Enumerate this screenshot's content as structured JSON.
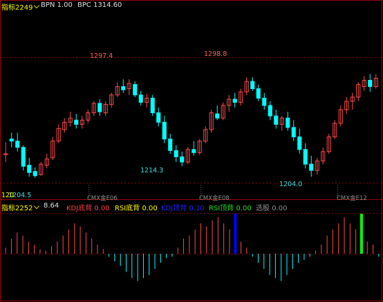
{
  "top_bar": {
    "indicator_name": "指标2249",
    "bpn_label": "BPN",
    "bpn_value": "1.00",
    "bpc_label": "BPC",
    "bpc_value": "1314.60"
  },
  "price_annotations": {
    "high1": "1297.4",
    "high2": "1298.8",
    "low1": "1214.3",
    "low2": "1204.0",
    "left_low": "1204.5",
    "left_axis_stub": "120"
  },
  "period_labels": [
    "CMX金E06",
    "CMX金E08",
    "CMX金E12"
  ],
  "sub_bar": {
    "indicator_name": "指标2252",
    "value": "8.64",
    "kdj_bottom": {
      "label": "KDJ底背",
      "value": "0.00"
    },
    "rsi_bottom": {
      "label": "RSI底背",
      "value": "0.00"
    },
    "kdj_top": {
      "label": "KDJ顶背",
      "value": "0.10"
    },
    "rsi_top": {
      "label": "RSI顶背",
      "value": "0.00"
    },
    "select": {
      "label": "选股",
      "value": "0.00"
    }
  },
  "colors": {
    "up": "#ff4a4a",
    "down": "#00ffff",
    "bg": "#000000",
    "grid": "#8b0000",
    "blue_bar": "#0000ff",
    "green_bar": "#00ff00",
    "yellow": "#ffff00"
  },
  "chart_data": {
    "type": "candlestick",
    "title": "",
    "ylim": [
      1195,
      1320
    ],
    "candles": [
      [
        1225,
        1237,
        1218,
        1226
      ],
      [
        1240,
        1246,
        1232,
        1238
      ],
      [
        1238,
        1246,
        1228,
        1232
      ],
      [
        1232,
        1234,
        1210,
        1214
      ],
      [
        1215,
        1222,
        1204,
        1208
      ],
      [
        1209,
        1213,
        1203,
        1205
      ],
      [
        1206,
        1218,
        1205,
        1216
      ],
      [
        1215,
        1226,
        1212,
        1221
      ],
      [
        1222,
        1242,
        1220,
        1238
      ],
      [
        1238,
        1254,
        1236,
        1250
      ],
      [
        1249,
        1260,
        1246,
        1256
      ],
      [
        1256,
        1266,
        1252,
        1260
      ],
      [
        1258,
        1264,
        1250,
        1254
      ],
      [
        1254,
        1262,
        1250,
        1258
      ],
      [
        1258,
        1268,
        1255,
        1265
      ],
      [
        1265,
        1276,
        1262,
        1274
      ],
      [
        1274,
        1278,
        1262,
        1266
      ],
      [
        1265,
        1276,
        1262,
        1273
      ],
      [
        1273,
        1284,
        1270,
        1282
      ],
      [
        1282,
        1294,
        1280,
        1290
      ],
      [
        1290,
        1297,
        1284,
        1287
      ],
      [
        1288,
        1297,
        1282,
        1293
      ],
      [
        1292,
        1295,
        1280,
        1282
      ],
      [
        1282,
        1286,
        1272,
        1275
      ],
      [
        1275,
        1283,
        1270,
        1279
      ],
      [
        1279,
        1282,
        1262,
        1265
      ],
      [
        1265,
        1270,
        1252,
        1256
      ],
      [
        1256,
        1262,
        1236,
        1240
      ],
      [
        1240,
        1245,
        1226,
        1229
      ],
      [
        1229,
        1234,
        1218,
        1223
      ],
      [
        1223,
        1228,
        1214,
        1218
      ],
      [
        1218,
        1232,
        1216,
        1230
      ],
      [
        1230,
        1238,
        1224,
        1227
      ],
      [
        1227,
        1240,
        1225,
        1238
      ],
      [
        1238,
        1252,
        1236,
        1249
      ],
      [
        1249,
        1268,
        1246,
        1265
      ],
      [
        1264,
        1272,
        1258,
        1260
      ],
      [
        1260,
        1275,
        1258,
        1272
      ],
      [
        1272,
        1282,
        1266,
        1278
      ],
      [
        1278,
        1284,
        1270,
        1275
      ],
      [
        1275,
        1288,
        1272,
        1285
      ],
      [
        1285,
        1299,
        1282,
        1295
      ],
      [
        1295,
        1299,
        1286,
        1288
      ],
      [
        1288,
        1292,
        1276,
        1279
      ],
      [
        1279,
        1284,
        1268,
        1272
      ],
      [
        1272,
        1276,
        1258,
        1262
      ],
      [
        1262,
        1268,
        1250,
        1254
      ],
      [
        1254,
        1262,
        1248,
        1260
      ],
      [
        1260,
        1266,
        1248,
        1251
      ],
      [
        1251,
        1258,
        1238,
        1242
      ],
      [
        1242,
        1250,
        1226,
        1230
      ],
      [
        1230,
        1236,
        1212,
        1216
      ],
      [
        1216,
        1224,
        1204,
        1210
      ],
      [
        1210,
        1222,
        1206,
        1219
      ],
      [
        1219,
        1232,
        1216,
        1228
      ],
      [
        1228,
        1245,
        1226,
        1242
      ],
      [
        1242,
        1258,
        1240,
        1255
      ],
      [
        1255,
        1272,
        1252,
        1268
      ],
      [
        1268,
        1280,
        1264,
        1276
      ],
      [
        1276,
        1284,
        1268,
        1280
      ],
      [
        1280,
        1294,
        1276,
        1292
      ],
      [
        1290,
        1300,
        1286,
        1296
      ],
      [
        1296,
        1302,
        1285,
        1290
      ],
      [
        1290,
        1302,
        1288,
        1298
      ]
    ]
  },
  "histogram": {
    "values": [
      4,
      10,
      14,
      12,
      8,
      6,
      3,
      2,
      5,
      8,
      12,
      16,
      20,
      18,
      14,
      10,
      6,
      3,
      -2,
      -5,
      -8,
      -12,
      -16,
      -18,
      -16,
      -14,
      -10,
      -6,
      -3,
      -2,
      4,
      10,
      12,
      16,
      20,
      18,
      22,
      24,
      20,
      16,
      12,
      8,
      4,
      -2,
      -6,
      -10,
      -14,
      -16,
      -18,
      -14,
      -10,
      -6,
      -4,
      -2,
      2,
      6,
      12,
      16,
      20,
      24,
      20,
      16,
      12,
      8,
      6,
      -2
    ],
    "special": {
      "blue_index": 40,
      "green_index": 62
    }
  }
}
